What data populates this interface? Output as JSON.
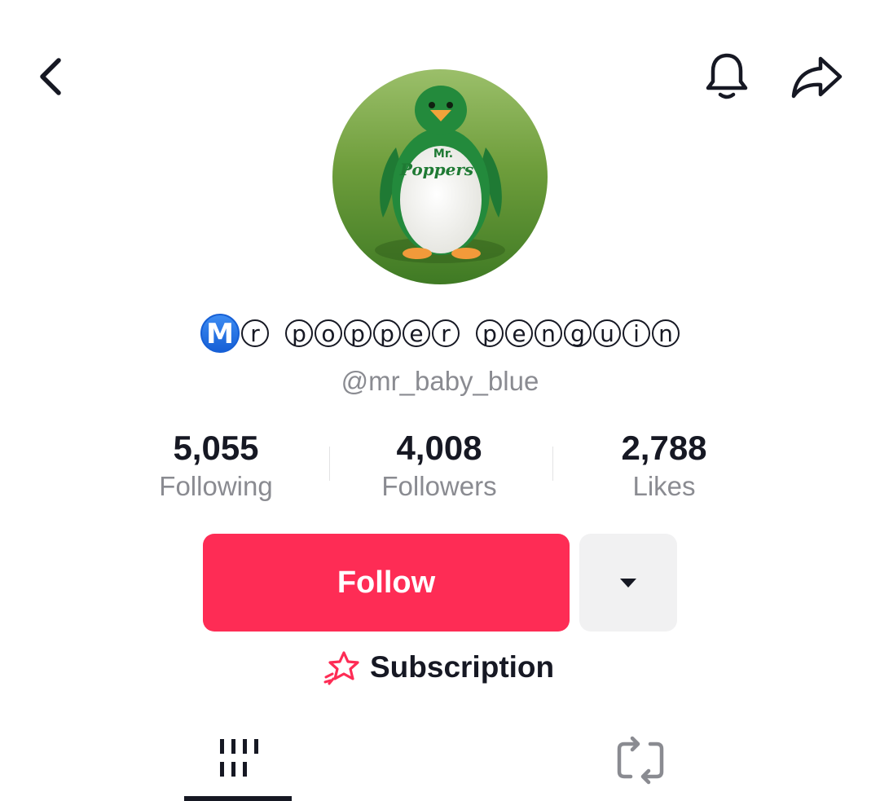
{
  "header": {
    "back_icon": "chevron-left-icon",
    "notification_icon": "bell-icon",
    "share_icon": "share-arrow-icon"
  },
  "profile": {
    "avatar_description_icon": "avatar-penguin-image",
    "avatar_text": "Mr. Poppers",
    "display_name_letters": [
      "M",
      "r",
      "p",
      "o",
      "p",
      "p",
      "e",
      "r",
      "p",
      "e",
      "n",
      "g",
      "u",
      "i",
      "n"
    ],
    "username": "@mr_baby_blue"
  },
  "stats": [
    {
      "value": "5,055",
      "label": "Following"
    },
    {
      "value": "4,008",
      "label": "Followers"
    },
    {
      "value": "2,788",
      "label": "Likes"
    }
  ],
  "actions": {
    "follow_label": "Follow",
    "more_icon": "caret-down-icon",
    "subscription_label": "Subscription",
    "subscription_icon": "star-rocket-icon"
  },
  "tabs": [
    {
      "name": "videos",
      "icon": "grid-bars-icon",
      "active": true
    },
    {
      "name": "reposts",
      "icon": "repost-icon",
      "active": false
    }
  ],
  "colors": {
    "accent": "#fe2c55",
    "text": "#161823",
    "muted": "#8a8b91",
    "badge_blue": "#1760d6"
  }
}
